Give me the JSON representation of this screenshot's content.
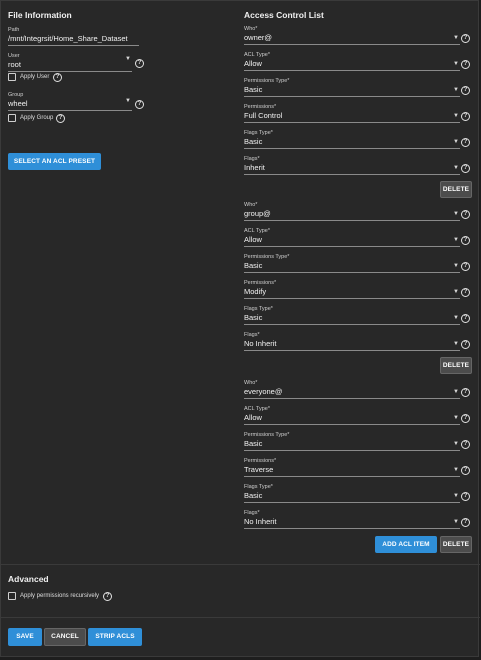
{
  "file_info": {
    "title": "File Information",
    "path_label": "Path",
    "path_value": "/mnt/Integrsit/Home_Share_Dataset",
    "user_label": "User",
    "user_value": "root",
    "apply_user_label": "Apply User",
    "group_label": "Group",
    "group_value": "wheel",
    "apply_group_label": "Apply Group",
    "preset_button": "SELECT AN ACL PRESET"
  },
  "acl": {
    "title": "Access Control List",
    "labels": {
      "who": "Who*",
      "acl_type": "ACL Type*",
      "perm_type": "Permissions Type*",
      "perms": "Permissions*",
      "flags_type": "Flags Type*",
      "flags": "Flags*"
    },
    "items": [
      {
        "who": "owner@",
        "acl_type": "Allow",
        "perm_type": "Basic",
        "perms": "Full Control",
        "flags_type": "Basic",
        "flags": "Inherit"
      },
      {
        "who": "group@",
        "acl_type": "Allow",
        "perm_type": "Basic",
        "perms": "Modify",
        "flags_type": "Basic",
        "flags": "No Inherit"
      },
      {
        "who": "everyone@",
        "acl_type": "Allow",
        "perm_type": "Basic",
        "perms": "Traverse",
        "flags_type": "Basic",
        "flags": "No Inherit"
      }
    ],
    "delete_label": "DELETE",
    "add_item_label": "ADD ACL ITEM"
  },
  "advanced": {
    "title": "Advanced",
    "recursive_label": "Apply permissions recursively"
  },
  "footer": {
    "save": "SAVE",
    "cancel": "CANCEL",
    "strip": "STRIP ACLS"
  },
  "colors": {
    "accent": "#2f8fd8",
    "panel": "#282828",
    "background": "#1e1e1e"
  }
}
